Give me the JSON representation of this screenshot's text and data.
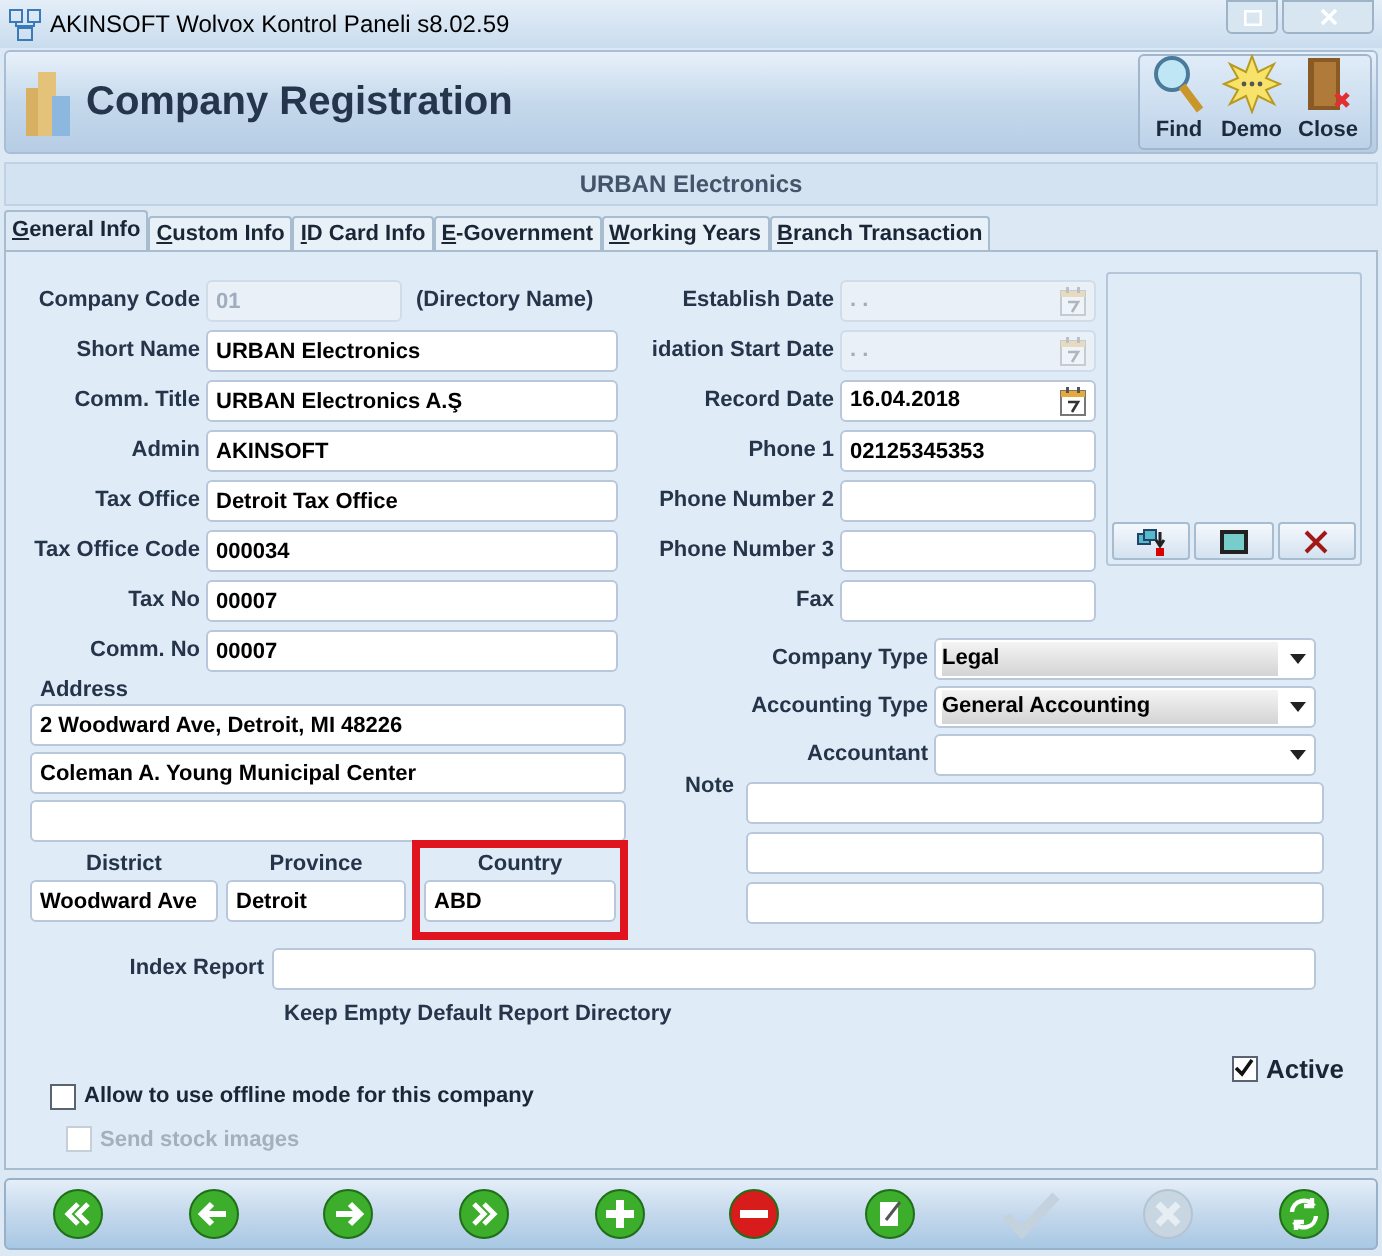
{
  "window": {
    "title": "AKINSOFT Wolvox Kontrol Paneli s8.02.59"
  },
  "header": {
    "title": "Company Registration",
    "actions": [
      {
        "kind": "find",
        "label": "Find"
      },
      {
        "kind": "demo",
        "label": "Demo"
      },
      {
        "kind": "close",
        "label": "Close"
      }
    ]
  },
  "company_banner": "URBAN Electronics",
  "tabs": [
    {
      "label": "General Info",
      "selected": true
    },
    {
      "label": "Custom Info",
      "selected": false
    },
    {
      "label": "ID Card Info",
      "selected": false
    },
    {
      "label": "E-Government",
      "selected": false
    },
    {
      "label": "Working Years",
      "selected": false
    },
    {
      "label": "Branch Transaction",
      "selected": false
    }
  ],
  "left_fields": [
    {
      "label": "Company Code",
      "value": "01",
      "disabled": true,
      "note": "(Directory Name)"
    },
    {
      "label": "Short Name",
      "value": "URBAN Electronics",
      "disabled": false
    },
    {
      "label": "Comm. Title",
      "value": "URBAN Electronics A.Ş",
      "disabled": false
    },
    {
      "label": "Admin",
      "value": "AKINSOFT",
      "disabled": false
    },
    {
      "label": "Tax Office",
      "value": "Detroit Tax Office",
      "disabled": false
    },
    {
      "label": "Tax Office Code",
      "value": "000034",
      "disabled": false
    },
    {
      "label": "Tax No",
      "value": "00007",
      "disabled": false
    },
    {
      "label": "Comm. No",
      "value": "00007",
      "disabled": false
    }
  ],
  "middle_fields": [
    {
      "label": "Establish Date",
      "value": ". .",
      "kind": "date",
      "disabled": true
    },
    {
      "label": "idation Start Date",
      "value": ". .",
      "kind": "date",
      "disabled": true
    },
    {
      "label": "Record Date",
      "value": "16.04.2018",
      "kind": "date",
      "disabled": false
    },
    {
      "label": "Phone 1",
      "value": "02125345353",
      "kind": "text",
      "disabled": false
    },
    {
      "label": "Phone Number 2",
      "kind": "text",
      "disabled": false
    },
    {
      "label": "Phone Number 3",
      "kind": "text",
      "disabled": false
    },
    {
      "label": "Fax",
      "kind": "text",
      "disabled": false
    }
  ],
  "logo_buttons": [
    {
      "kind": "load"
    },
    {
      "kind": "view"
    },
    {
      "kind": "delete"
    }
  ],
  "address": {
    "label": "Address",
    "lines": [
      "2 Woodward Ave, Detroit, MI 48226",
      "Coleman A. Young Municipal Center"
    ],
    "parts": [
      {
        "label": "District",
        "value": "Woodward Ave",
        "highlighted": false
      },
      {
        "label": "Province",
        "value": "Detroit",
        "highlighted": false
      },
      {
        "label": "Country",
        "value": "ABD",
        "highlighted": true
      }
    ]
  },
  "dropdowns": [
    {
      "label": "Company Type",
      "value": "Legal"
    },
    {
      "label": "Accounting Type",
      "value": "General Accounting"
    },
    {
      "label": "Accountant"
    }
  ],
  "note": {
    "label": "Note"
  },
  "index_report": {
    "label": "Index Report",
    "hint": "Keep Empty Default Report Directory"
  },
  "active": {
    "label": "Active",
    "checked": true
  },
  "options": [
    {
      "label": "Allow to use offline mode for this company",
      "checked": false,
      "disabled": false
    },
    {
      "label": "Send stock images",
      "checked": false,
      "disabled": true
    }
  ],
  "toolbar": [
    {
      "kind": "first",
      "disabled": false
    },
    {
      "kind": "prev",
      "disabled": false
    },
    {
      "kind": "next",
      "disabled": false
    },
    {
      "kind": "last",
      "disabled": false
    },
    {
      "kind": "add",
      "disabled": false
    },
    {
      "kind": "remove",
      "disabled": false
    },
    {
      "kind": "edit",
      "disabled": false
    },
    {
      "kind": "save",
      "disabled": true
    },
    {
      "kind": "cancel",
      "disabled": true
    },
    {
      "kind": "refresh",
      "disabled": false
    }
  ]
}
